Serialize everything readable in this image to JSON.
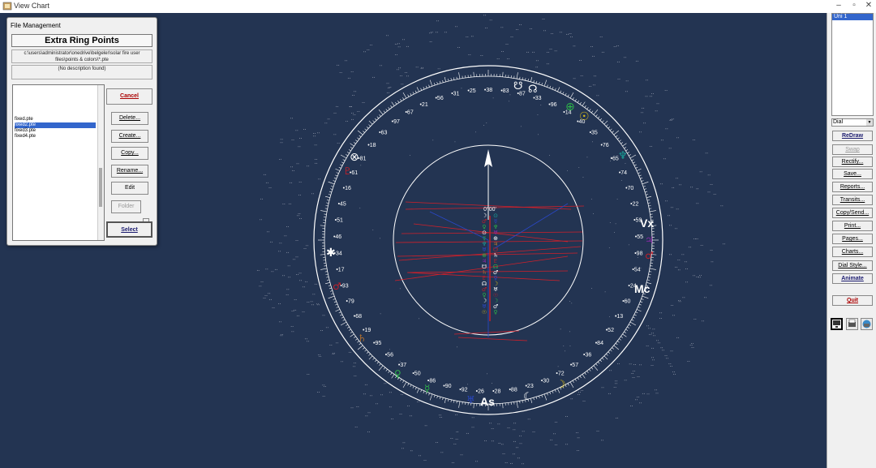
{
  "window": {
    "title": "View Chart"
  },
  "dialog": {
    "title": "File Management",
    "heading": "Extra Ring Points",
    "path_line1": "c:\\users\\administrator\\onedrive\\belgeler\\solar fire user",
    "path_line2": "files\\points & colors\\*.pte",
    "description": "(No description found)",
    "files": [
      "fixed.pte",
      "fixed2.pte",
      "fixed3.pte",
      "fixed4.pte"
    ],
    "selected_file": "fixed2.pte",
    "buttons": {
      "cancel": "Cancel",
      "delete": "Delete...",
      "create": "Create...",
      "copy": "Copy...",
      "rename": "Rename...",
      "edit": "Edit",
      "folder": "Folder",
      "select": "Select"
    }
  },
  "sidebar": {
    "list_item": "Uni 1",
    "dropdown_value": "Dial",
    "buttons": [
      "ReDraw",
      "Swap",
      "Rectify...",
      "Save...",
      "Reports...",
      "Transits...",
      "Copy/Send...",
      "Print...",
      "Pages...",
      "Charts...",
      "Dial Style...",
      "Animate",
      "Quit"
    ]
  },
  "chart": {
    "center_label": "0°00'",
    "tick_labels": [
      "38",
      "83",
      "87",
      "33",
      "96",
      "14",
      "40",
      "35",
      "76",
      "65",
      "74",
      "70",
      "22",
      "59",
      "55",
      "98",
      "54",
      "24",
      "60",
      "13",
      "52",
      "84",
      "36",
      "57",
      "72",
      "30",
      "23",
      "88",
      "28",
      "26",
      "92",
      "90",
      "86",
      "50",
      "37",
      "56",
      "95",
      "19",
      "68",
      "79",
      "93",
      "17",
      "34",
      "46",
      "51",
      "45",
      "16",
      "61",
      "81",
      "18",
      "63",
      "97",
      "67",
      "21",
      "56",
      "31",
      "25"
    ],
    "labels": {
      "vx": "Vx",
      "mc": "Mc",
      "as": "As"
    },
    "colors": {
      "background": "#233452",
      "ring": "#ffffff",
      "red_lines": "#d0202a",
      "blue_lines": "#2a48c8"
    }
  }
}
